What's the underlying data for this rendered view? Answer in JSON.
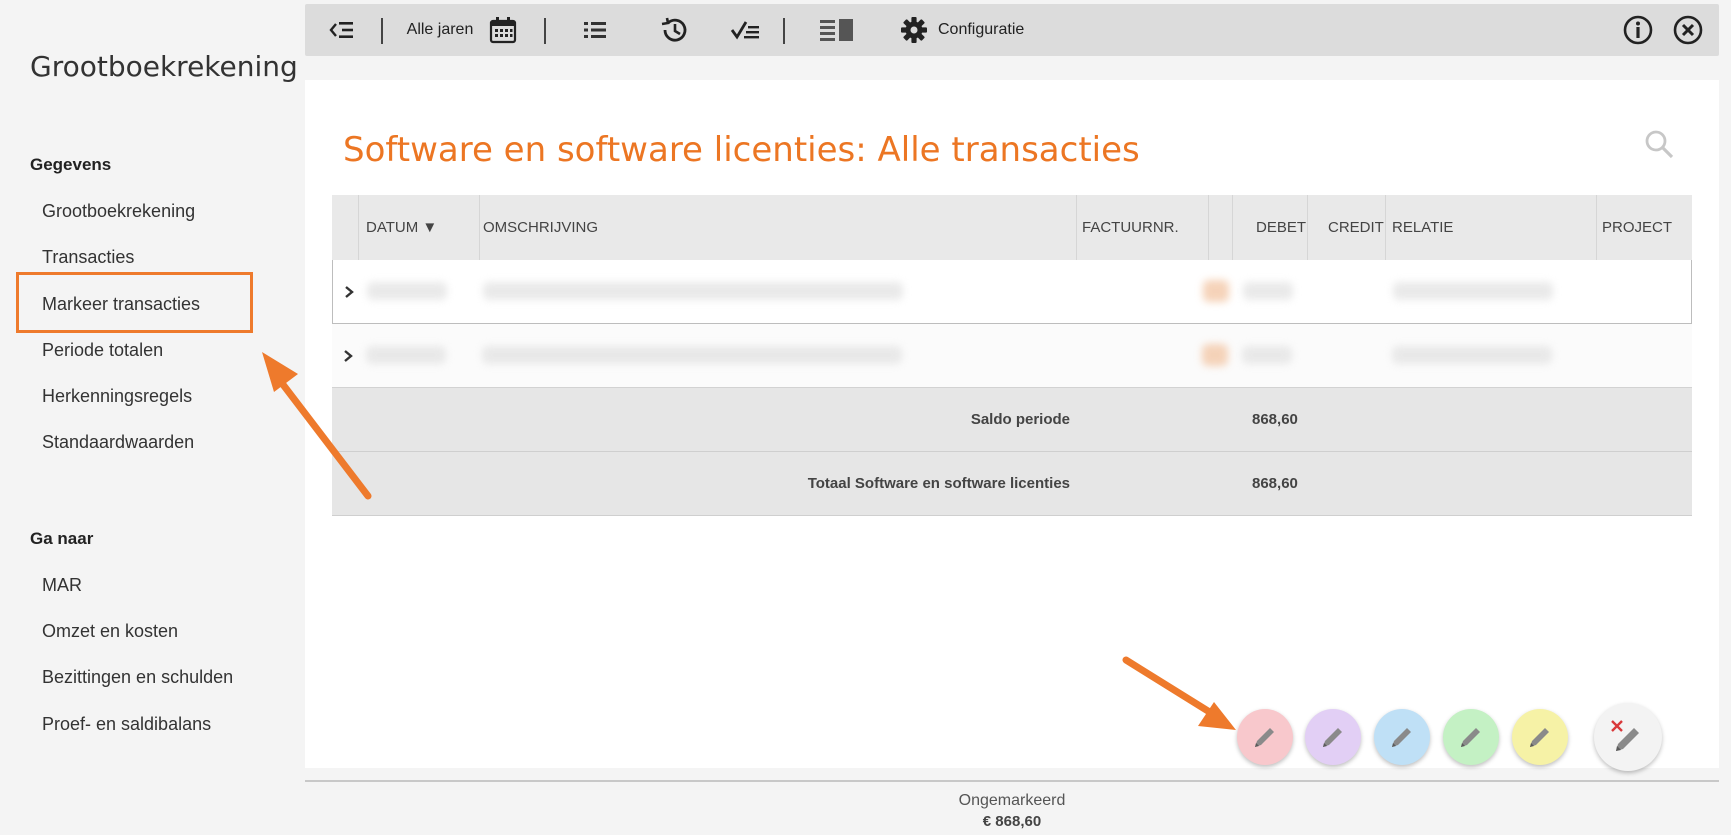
{
  "sidebar": {
    "title": "Grootboekrekening",
    "section_data": "Gegevens",
    "data_items": [
      "Grootboekrekening",
      "Transacties",
      "Markeer transacties",
      "Periode totalen",
      "Herkenningsregels",
      "Standaardwaarden"
    ],
    "section_goto": "Ga naar",
    "goto_items": [
      "MAR",
      "Omzet en kosten",
      "Bezittingen en schulden",
      "Proef- en saldibalans"
    ],
    "highlighted_item": "Markeer transacties"
  },
  "toolbar": {
    "year_label": "Alle jaren",
    "config_label": "Configuratie"
  },
  "main": {
    "title": "Software en software licenties: Alle transacties",
    "columns": [
      "DATUM ▼",
      "OMSCHRIJVING",
      "FACTUURNR.",
      "DEBET",
      "CREDIT",
      "RELATIE",
      "PROJECT"
    ],
    "summary": [
      {
        "label": "Saldo periode",
        "debet": "868,60"
      },
      {
        "label": "Totaal Software en software licenties",
        "debet": "868,60"
      }
    ]
  },
  "markers": {
    "colors": [
      "#f8c8cc",
      "#e2cff5",
      "#bfe0f6",
      "#c4f1c4",
      "#f6f2a6"
    ],
    "clear_color": "#f3f3f3"
  },
  "footer": {
    "status": "Ongemarkeerd",
    "amount": "€ 868,60"
  },
  "accent_color": "#ec7623"
}
